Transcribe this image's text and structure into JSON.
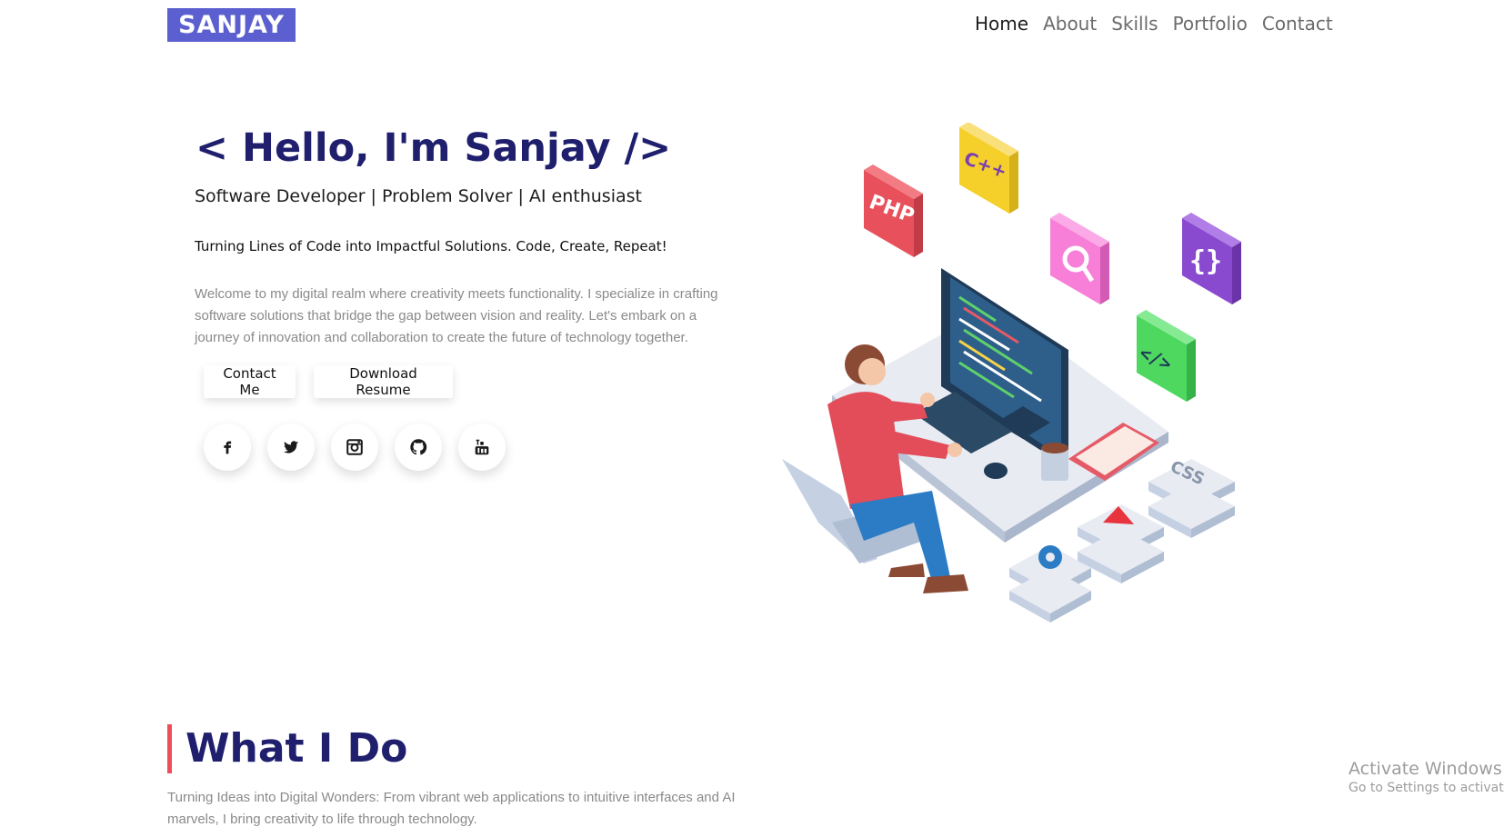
{
  "logo": "SANJAY",
  "nav": {
    "items": [
      "Home",
      "About",
      "Skills",
      "Portfolio",
      "Contact"
    ],
    "active": "Home"
  },
  "hero": {
    "title": "< Hello, I'm Sanjay />",
    "subtitle": "Software Developer | Problem Solver | AI enthusiast",
    "tagline": "Turning Lines of Code into Impactful Solutions. Code, Create, Repeat!",
    "description": "Welcome to my digital realm where creativity meets functionality. I specialize in crafting software solutions that bridge the gap between vision and reality. Let's embark on a journey of innovation and collaboration to create the future of technology together.",
    "buttons": {
      "contact": "Contact Me",
      "resume": "Download Resume"
    },
    "social": [
      "facebook-icon",
      "twitter-icon",
      "instagram-icon",
      "github-icon",
      "youtube-icon"
    ],
    "tile_labels": {
      "php": "PHP",
      "cpp": "C++",
      "css": "CSS"
    }
  },
  "what_i_do": {
    "title": "What I Do",
    "description": "Turning Ideas into Digital Wonders: From vibrant web applications to intuitive interfaces and AI marvels, I bring creativity to life through technology."
  },
  "os_notice": {
    "line1": "Activate Windows",
    "line2": "Go to Settings to activate Windows."
  },
  "colors": {
    "brand": "#5b5fcf",
    "heading": "#1f1f6e",
    "accent": "#ef4d5a",
    "muted_text": "#8a8a8a"
  }
}
